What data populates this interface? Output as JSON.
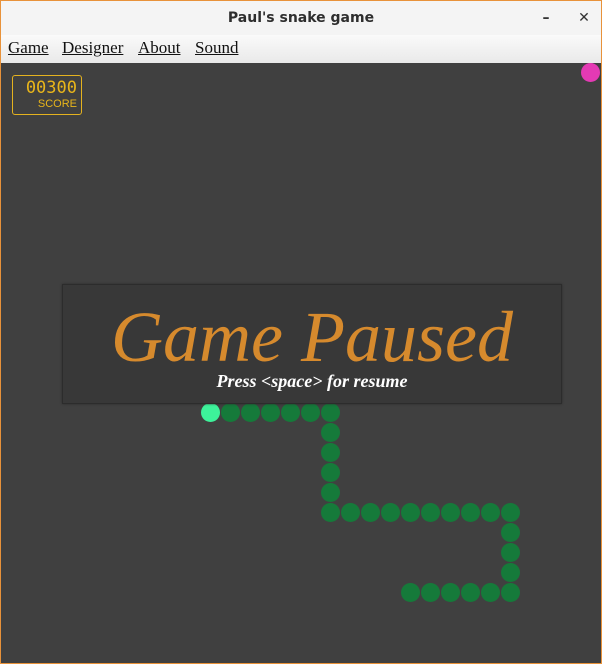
{
  "window": {
    "title": "Paul's snake game"
  },
  "menu": {
    "game": "Game",
    "designer": "Designer",
    "about": "About",
    "sound": "Sound"
  },
  "score": {
    "value": "00300",
    "label": "SCORE"
  },
  "pause": {
    "title": "Game Paused",
    "subtitle": "Press <space> for resume"
  },
  "colors": {
    "background": "#404040",
    "snake": "#157a3a",
    "snake_head": "#3df29a",
    "food": "#e43ab4",
    "score": "#e8b51a",
    "pause_title": "#d68a2d"
  },
  "game": {
    "cols": 30,
    "rows": 30,
    "snake": [
      [
        10,
        17
      ],
      [
        11,
        17
      ],
      [
        12,
        17
      ],
      [
        13,
        17
      ],
      [
        14,
        17
      ],
      [
        15,
        17
      ],
      [
        16,
        17
      ],
      [
        16,
        18
      ],
      [
        16,
        19
      ],
      [
        16,
        20
      ],
      [
        16,
        21
      ],
      [
        16,
        22
      ],
      [
        17,
        22
      ],
      [
        18,
        22
      ],
      [
        19,
        22
      ],
      [
        20,
        22
      ],
      [
        21,
        22
      ],
      [
        22,
        22
      ],
      [
        23,
        22
      ],
      [
        24,
        22
      ],
      [
        25,
        22
      ],
      [
        25,
        23
      ],
      [
        25,
        24
      ],
      [
        25,
        25
      ],
      [
        25,
        26
      ],
      [
        24,
        26
      ],
      [
        23,
        26
      ],
      [
        22,
        26
      ],
      [
        21,
        26
      ],
      [
        20,
        26
      ]
    ],
    "food": [
      29,
      0
    ]
  }
}
